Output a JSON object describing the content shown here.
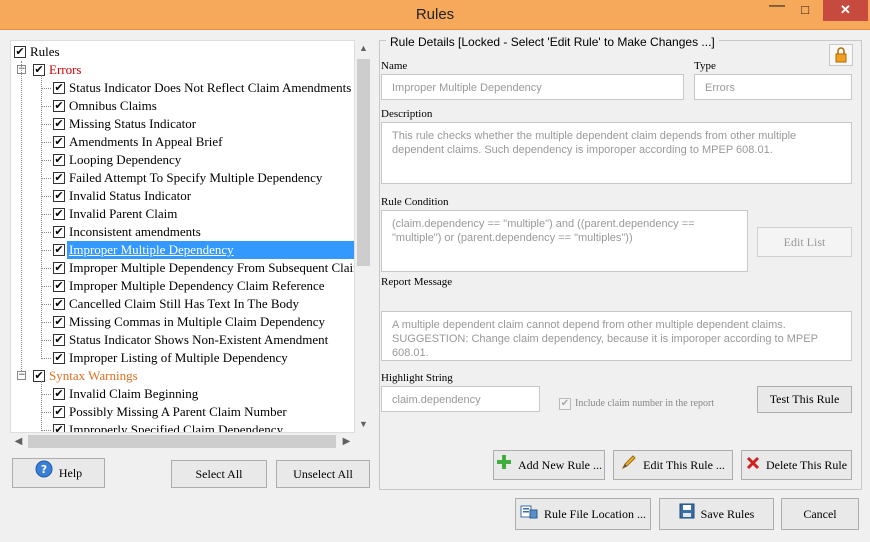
{
  "window": {
    "title": "Rules",
    "min": "—",
    "max": "□",
    "close": "✕"
  },
  "tree": {
    "root": "Rules",
    "groups": [
      {
        "label": "Errors",
        "color": "#cc0000",
        "items": [
          "Status Indicator Does Not Reflect Claim Amendments",
          "Omnibus Claims",
          "Missing Status Indicator",
          "Amendments In Appeal Brief",
          "Looping Dependency",
          "Failed Attempt To Specify Multiple Dependency",
          "Invalid Status Indicator",
          "Invalid Parent Claim",
          "Inconsistent amendments",
          "Improper Multiple Dependency",
          "Improper Multiple Dependency From Subsequent Claim",
          "Improper Multiple Dependency Claim Reference",
          "Cancelled Claim Still Has Text In The Body",
          "Missing Commas in Multiple Claim Dependency",
          "Status Indicator Shows Non-Existent Amendment",
          "Improper Listing of Multiple Dependency"
        ]
      },
      {
        "label": "Syntax Warnings",
        "color": "#e07020",
        "items": [
          "Invalid Claim Beginning",
          "Possibly Missing A Parent Claim Number",
          "Improperly Specified Claim Dependency"
        ]
      }
    ],
    "selected": "Improper Multiple Dependency"
  },
  "buttons": {
    "help": "Help",
    "select_all": "Select All",
    "unselect_all": "Unselect All",
    "add_new_rule": "Add New Rule ...",
    "edit_this_rule": "Edit This Rule ...",
    "delete_this_rule": "Delete This Rule",
    "rule_file_location": "Rule File Location ...",
    "save_rules": "Save Rules",
    "cancel": "Cancel",
    "edit_list": "Edit List",
    "test_this_rule": "Test This Rule"
  },
  "details": {
    "group_title": "Rule Details   [Locked - Select 'Edit Rule' to Make Changes ...]",
    "name_label": "Name",
    "name_value": "Improper Multiple Dependency",
    "type_label": "Type",
    "type_value": "Errors",
    "description_label": "Description",
    "description_value": "This rule checks whether the multiple dependent claim depends from other multiple dependent claims. Such dependency is imporoper according to MPEP 608.01.",
    "condition_label": "Rule Condition",
    "condition_value": "(claim.dependency == \"multiple\") and ((parent.dependency == \"multiple\") or (parent.dependency == \"multiples\"))",
    "report_label": "Report Message",
    "report_value": "A multiple dependent claim cannot depend from other multiple dependent claims. SUGGESTION: Change claim dependency, because it is imporoper according to MPEP 608.01.",
    "highlight_label": "Highlight String",
    "highlight_value": "claim.dependency",
    "include_claim_label": "Include claim number in the report"
  }
}
